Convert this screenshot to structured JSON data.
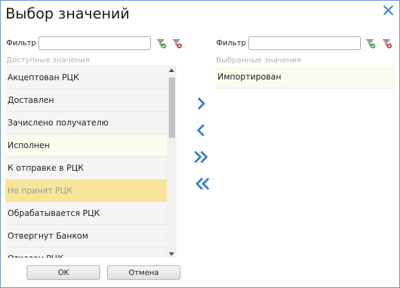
{
  "dialog": {
    "title": "Выбор значений",
    "ok_label": "OK",
    "cancel_label": "Отмена"
  },
  "left": {
    "filter_label": "Фильтр",
    "filter_value": "",
    "caption": "Доступные значения",
    "items": [
      "Акцептован РЦК",
      "Доставлен",
      "Зачислено получателю",
      "Исполнен",
      "К отправке в РЦК",
      "Не принят РЦК",
      "Обрабатывается РЦК",
      "Отвергнут Банком",
      "Отказан РЦК"
    ],
    "hovered_item": "Исполнен",
    "selected_item": "Не принят РЦК"
  },
  "right": {
    "filter_label": "Фильтр",
    "filter_value": "",
    "caption": "Выбранные значения",
    "items": [
      "Импортирован"
    ]
  },
  "colors": {
    "accent": "#2e7bd1",
    "selected_bg": "#f7e59a",
    "hover_bg": "#fbfbee",
    "filter_apply": "#3aa53a",
    "filter_clear": "#d9232e"
  },
  "icons": {
    "close": "close-icon",
    "filter_apply": "filter-apply-icon",
    "filter_clear": "filter-clear-icon",
    "move_right": "chevron-right-icon",
    "move_left": "chevron-left-icon",
    "move_all_right": "double-chevron-right-icon",
    "move_all_left": "double-chevron-left-icon"
  }
}
